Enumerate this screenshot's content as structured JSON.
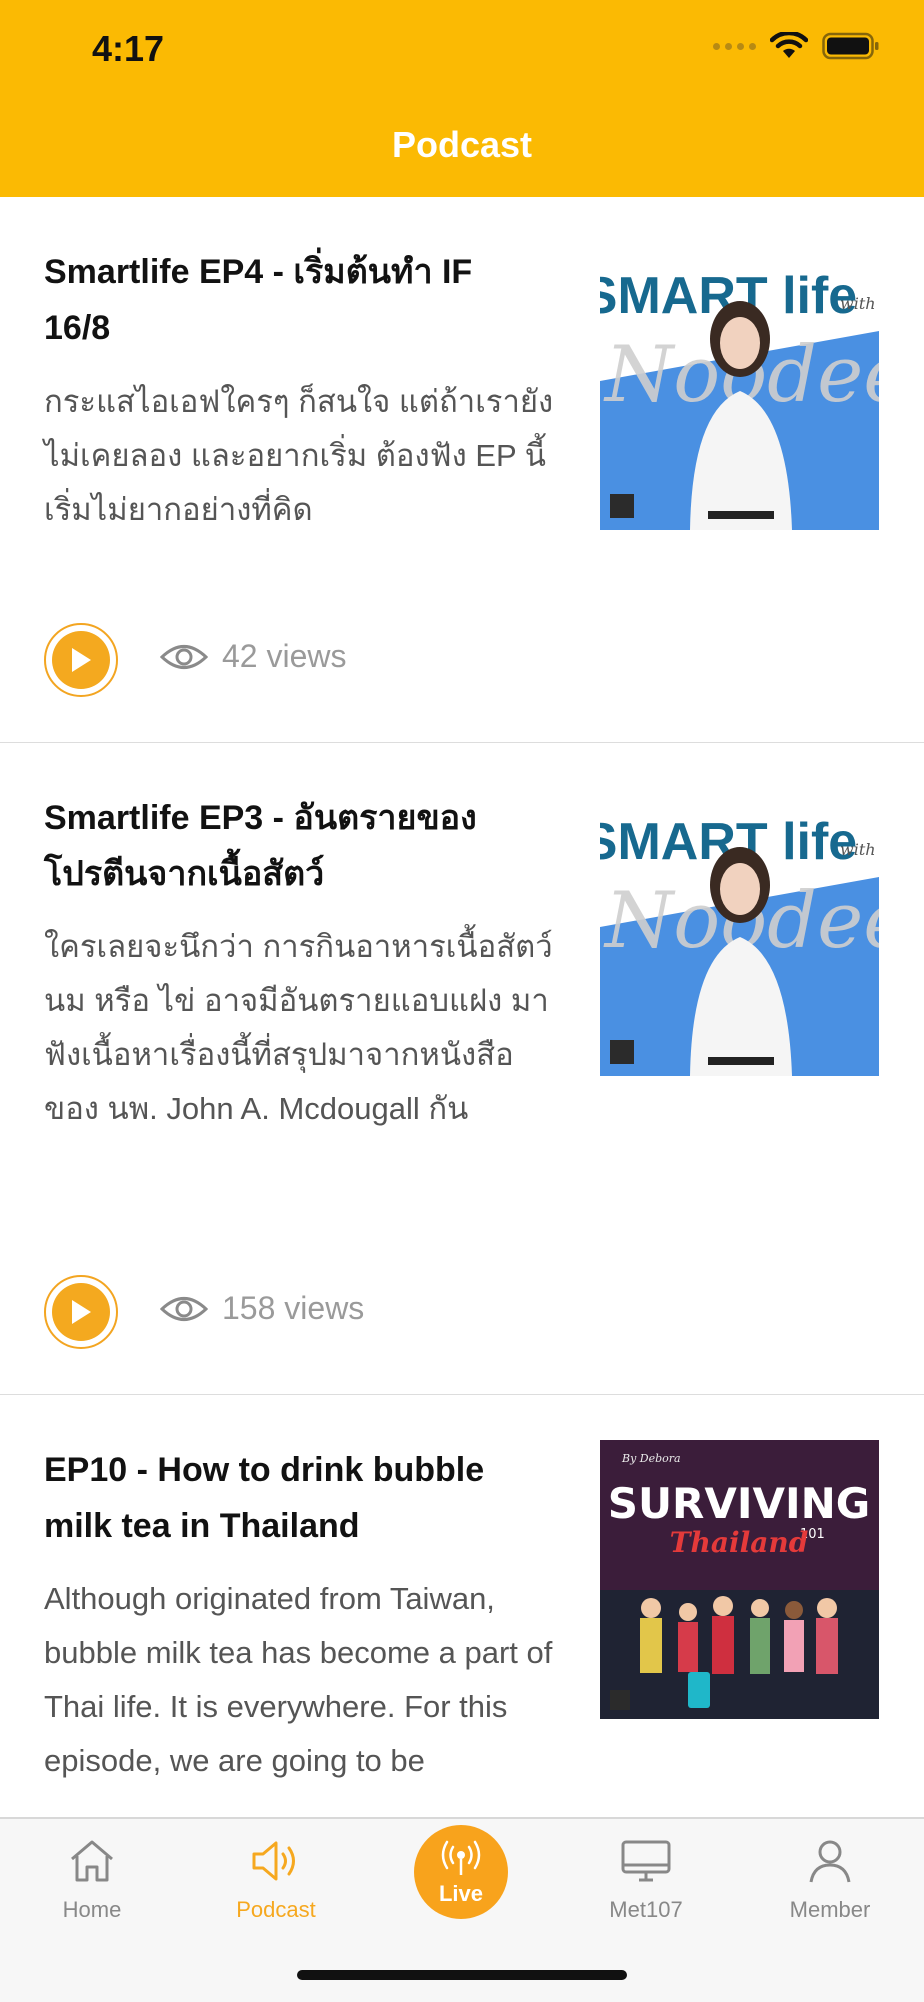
{
  "status_bar": {
    "time": "4:17"
  },
  "header": {
    "title": "Podcast"
  },
  "episodes": [
    {
      "title": "Smartlife EP4 - เริ่มต้นทำ IF 16/8",
      "description": "กระแสไอเอฟใครๆ ก็สนใจ แต่ถ้าเรายังไม่เคยลอง และอยากเริ่ม ต้องฟัง EP นี้ เริ่มไม่ยากอย่างที่คิด",
      "views": "42 views",
      "thumbnail": {
        "heading": "SMART life",
        "script": "Noodee",
        "sub": "with",
        "bg": "#4a90e2"
      }
    },
    {
      "title": "Smartlife EP3 - อันตรายของโปรตีนจากเนื้อสัตว์",
      "description": "ใครเลยจะนึกว่า การกินอาหารเนื้อสัตว์ นม หรือ ไข่ อาจมีอันตรายแอบแฝง มาฟังเนื้อหาเรื่องนี้ที่สรุปมาจากหนังสือของ นพ. John A. Mcdougall กัน",
      "views": "158 views",
      "thumbnail": {
        "heading": "SMART life",
        "script": "Noodee",
        "sub": "with",
        "bg": "#4a90e2"
      }
    },
    {
      "title": "EP10 - How to drink bubble milk tea in Thailand",
      "description": "Although originated from Taiwan, bubble milk tea has become a part of Thai life. It is everywhere. For this episode, we are going to be",
      "thumbnail": {
        "heading": "SURVIVING",
        "sub": "Thailand",
        "num": "101",
        "byline": "By Debora",
        "bg": "#3b1d3a"
      }
    }
  ],
  "tabbar": {
    "tabs": [
      {
        "label": "Home",
        "icon": "home-icon"
      },
      {
        "label": "Podcast",
        "icon": "speaker-icon",
        "active": true
      },
      {
        "label": "Live",
        "icon": "broadcast-icon"
      },
      {
        "label": "Met107",
        "icon": "monitor-icon"
      },
      {
        "label": "Member",
        "icon": "person-icon"
      }
    ]
  },
  "colors": {
    "accent": "#fbba03",
    "play": "#f4a91f",
    "active_tab": "#f6a81f"
  }
}
